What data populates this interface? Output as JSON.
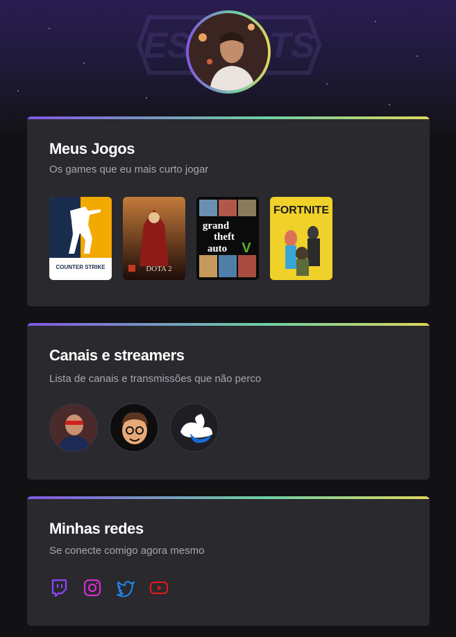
{
  "profile": {
    "avatar_icon": "user-avatar-photo"
  },
  "hero": {
    "logo_text": "ESPORTS"
  },
  "games_section": {
    "title": "Meus Jogos",
    "subtitle": "Os games que eu mais curto jogar",
    "games": [
      {
        "name": "Counter Strike",
        "label": "COUNTER STRIKE"
      },
      {
        "name": "Dota 2",
        "label": "DOTA 2"
      },
      {
        "name": "Grand Theft Auto V",
        "label_1": "grand",
        "label_2": "theft",
        "label_3": "auto"
      },
      {
        "name": "Fortnite",
        "label": "FORTNITE"
      }
    ]
  },
  "channels_section": {
    "title": "Canais e streamers",
    "subtitle": "Lista de canais e transmissões que não perco",
    "channels": [
      {
        "icon": "streamer-avatar-1"
      },
      {
        "icon": "streamer-avatar-2"
      },
      {
        "icon": "streamer-avatar-3"
      }
    ]
  },
  "social_section": {
    "title": "Minhas redes",
    "subtitle": "Se conecte comigo agora mesmo",
    "networks": [
      {
        "icon": "twitch-icon",
        "color": "#9146ff"
      },
      {
        "icon": "instagram-icon",
        "color": "#d62fd0"
      },
      {
        "icon": "twitter-icon",
        "color": "#1d8af2"
      },
      {
        "icon": "youtube-icon",
        "color": "#e01919"
      }
    ]
  },
  "colors": {
    "background": "#121214",
    "card": "#29292e",
    "gradient": [
      "#8257e5",
      "#6fd2a2",
      "#e1d55d"
    ],
    "title": "#ffffff",
    "subtitle": "#a8a8b3"
  }
}
